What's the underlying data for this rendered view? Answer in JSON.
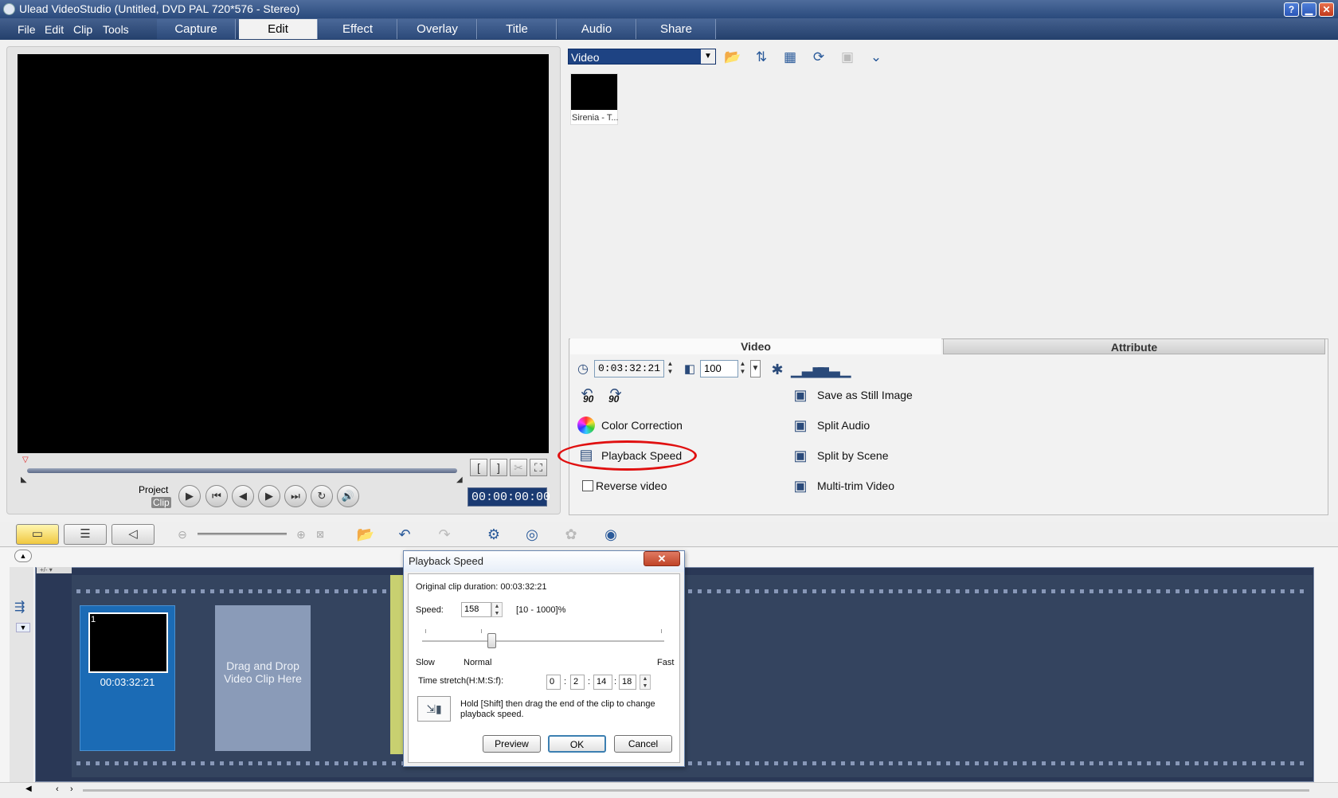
{
  "window": {
    "title": "Ulead VideoStudio (Untitled, DVD PAL 720*576 - Stereo)",
    "controls": {
      "help": "?",
      "minimize": "▁",
      "maximize": "▭",
      "close": "✕"
    }
  },
  "menu": [
    "File",
    "Edit",
    "Clip",
    "Tools"
  ],
  "steps": [
    "Capture",
    "Edit",
    "Effect",
    "Overlay",
    "Title",
    "Audio",
    "Share"
  ],
  "active_step": "Edit",
  "preview": {
    "project_label": "Project",
    "clip_label": "Clip",
    "timecode": "00:00:00:00",
    "buttons": {
      "play": "▶",
      "start": "⏮",
      "prev": "◀",
      "next": "▶",
      "end": "⏭",
      "repeat": "↻",
      "volume": "🔊"
    },
    "trim_buttons": [
      "[",
      "]",
      "✂",
      "⛶"
    ]
  },
  "library": {
    "category": "Video",
    "dropdown_arrow": "▼",
    "thumbnail_caption": "Sirenia - T...",
    "icons": [
      "folder-icon",
      "sort-icon",
      "view-icon",
      "refresh-icon",
      "library-manager-icon",
      "expand-icon"
    ]
  },
  "options": {
    "tabs": {
      "video": "Video",
      "attribute": "Attribute"
    },
    "duration": "0:03:32:21",
    "volume": "100",
    "rotate_left_label": "90",
    "rotate_right_label": "90",
    "color_correction": "Color Correction",
    "playback_speed": "Playback Speed",
    "reverse_video": "Reverse video",
    "save_still": "Save as Still Image",
    "split_audio": "Split Audio",
    "split_scene": "Split by Scene",
    "multi_trim": "Multi-trim Video"
  },
  "storyboard": {
    "clip_duration": "00:03:32:21",
    "clip_number": "1",
    "drop_hint": "Drag and Drop Video Clip Here"
  },
  "dialog": {
    "title": "Playback Speed",
    "close": "✕",
    "original_duration": "Original clip duration: 00:03:32:21",
    "speed_label": "Speed:",
    "speed_value": "158",
    "speed_range": "[10 - 1000]%",
    "slow": "Slow",
    "normal": "Normal",
    "fast": "Fast",
    "time_stretch_label": "Time stretch(H:M:S:f):",
    "h": "0",
    "m": "2",
    "s": "14",
    "f": "18",
    "hint": "Hold [Shift] then drag the end of the clip to change playback speed.",
    "preview": "Preview",
    "ok": "OK",
    "cancel": "Cancel",
    "speed_fraction": 0.27
  }
}
